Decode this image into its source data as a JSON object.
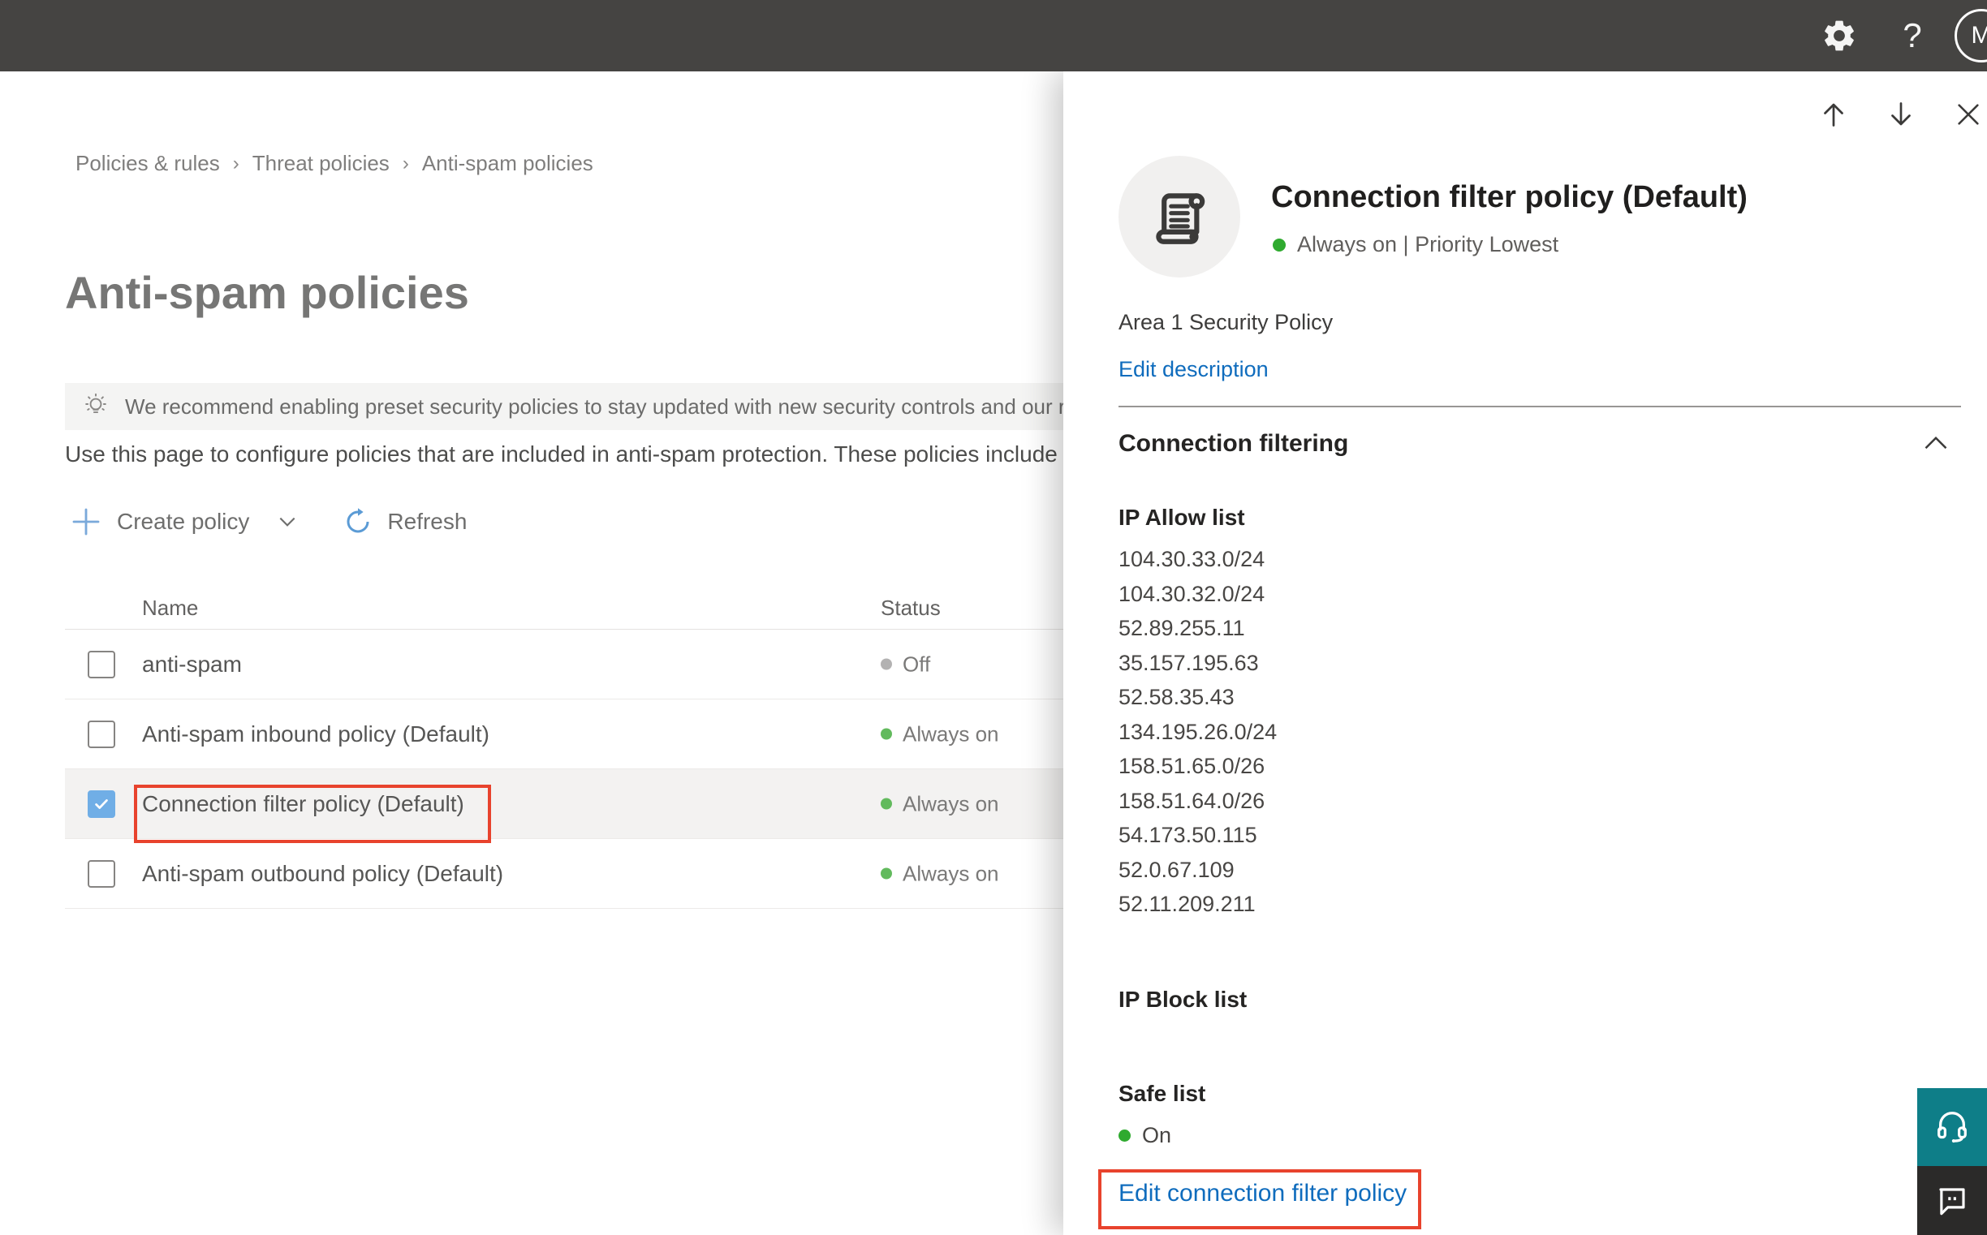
{
  "topbar": {
    "help_glyph": "?",
    "avatar_initial": "M",
    "icons": [
      "settings-gear",
      "help-question",
      "account-avatar"
    ]
  },
  "breadcrumb": {
    "items": [
      "Policies & rules",
      "Threat policies",
      "Anti-spam policies"
    ],
    "separator": "›"
  },
  "page": {
    "title": "Anti-spam policies",
    "banner_icon": "lightbulb",
    "banner_text": "We recommend enabling preset security policies to stay updated with new security controls and our recomme",
    "description": "Use this page to configure policies that are included in anti-spam protection. These policies include"
  },
  "toolbar": {
    "create_label": "Create policy",
    "create_icon": "plus",
    "refresh_label": "Refresh",
    "refresh_icon": "circular-arrow"
  },
  "table": {
    "columns": {
      "name": "Name",
      "status": "Status"
    },
    "rows": [
      {
        "name": "anti-spam",
        "status": "Off",
        "status_kind": "off",
        "checked": false,
        "selected": false
      },
      {
        "name": "Anti-spam inbound policy (Default)",
        "status": "Always on",
        "status_kind": "on",
        "checked": false,
        "selected": false
      },
      {
        "name": "Connection filter policy (Default)",
        "status": "Always on",
        "status_kind": "on",
        "checked": true,
        "selected": true,
        "annotated": true
      },
      {
        "name": "Anti-spam outbound policy (Default)",
        "status": "Always on",
        "status_kind": "on",
        "checked": false,
        "selected": false
      }
    ]
  },
  "flyout": {
    "nav_icons": [
      "arrow-up",
      "arrow-down",
      "close"
    ],
    "policy_icon": "scroll",
    "title": "Connection filter policy (Default)",
    "status_line": "Always on | Priority Lowest",
    "description": "Area 1 Security Policy",
    "edit_description_label": "Edit description",
    "section_title": "Connection filtering",
    "ip_allow": {
      "heading": "IP Allow list",
      "items": [
        "104.30.33.0/24",
        "104.30.32.0/24",
        "52.89.255.11",
        "35.157.195.63",
        "52.58.35.43",
        "134.195.26.0/24",
        "158.51.65.0/26",
        "158.51.64.0/26",
        "54.173.50.115",
        "52.0.67.109",
        "52.11.209.211"
      ]
    },
    "ip_block": {
      "heading": "IP Block list"
    },
    "safe_list": {
      "heading": "Safe list",
      "status": "On"
    },
    "edit_link_label": "Edit connection filter policy"
  },
  "corner_buttons": {
    "support_icon": "headset",
    "feedback_icon": "speech-bubble"
  },
  "colors": {
    "topbar_bg": "#454442",
    "accent_blue": "#0f6cbd",
    "toolbar_blue": "#5b9bd5",
    "status_green": "#62ba5d",
    "status_gray": "#b3b2b2",
    "annotation_red": "#e8432d",
    "checkbox_blue": "#70aee6",
    "support_teal": "#0e7e88",
    "selected_row_bg": "#f3f2f1"
  }
}
